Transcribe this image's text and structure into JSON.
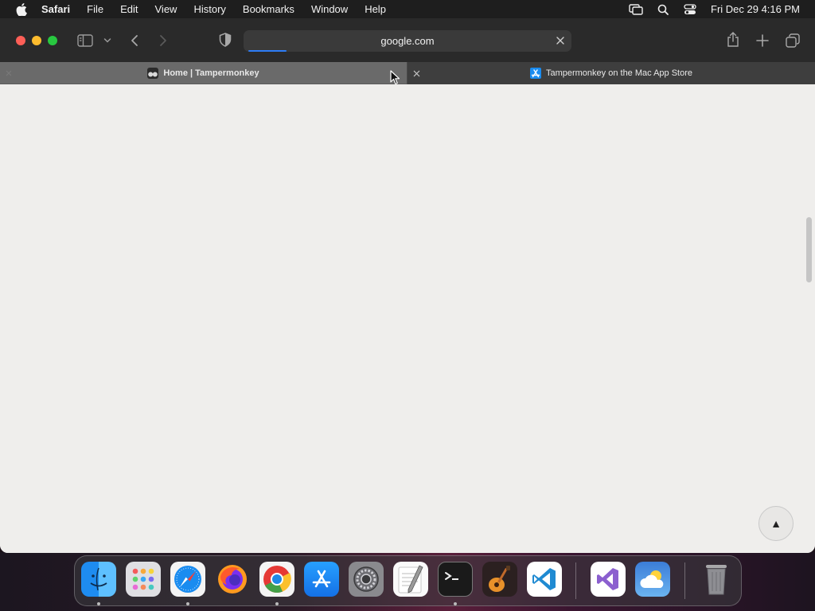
{
  "menubar": {
    "app_name": "Safari",
    "items": [
      "File",
      "Edit",
      "View",
      "History",
      "Bookmarks",
      "Window",
      "Help"
    ],
    "clock": "Fri Dec 29  4:16 PM",
    "status_icons": [
      "screen-mirroring-icon",
      "spotlight-search-icon",
      "control-center-icon"
    ]
  },
  "toolbar": {
    "address_text": "google.com",
    "load_progress_fraction": 0.12
  },
  "tabs": [
    {
      "title": "Home | Tampermonkey",
      "active": true,
      "favicon": "tampermonkey-icon"
    },
    {
      "title": "Tampermonkey on the Mac App Store",
      "active": false,
      "favicon": "app-store-icon"
    }
  ],
  "content": {
    "scroll_top_label": "▲"
  },
  "dock": {
    "apps": [
      "Finder",
      "Launchpad",
      "Safari",
      "Firefox",
      "Google Chrome",
      "App Store",
      "System Settings",
      "TextEdit",
      "Terminal",
      "GarageBand",
      "Visual Studio Code",
      "Visual Studio",
      "Weather",
      "Trash"
    ]
  },
  "colors": {
    "accent": "#2d7cf6",
    "close": "#fe5f57",
    "minimize": "#febc2e",
    "maximize": "#28c840"
  }
}
